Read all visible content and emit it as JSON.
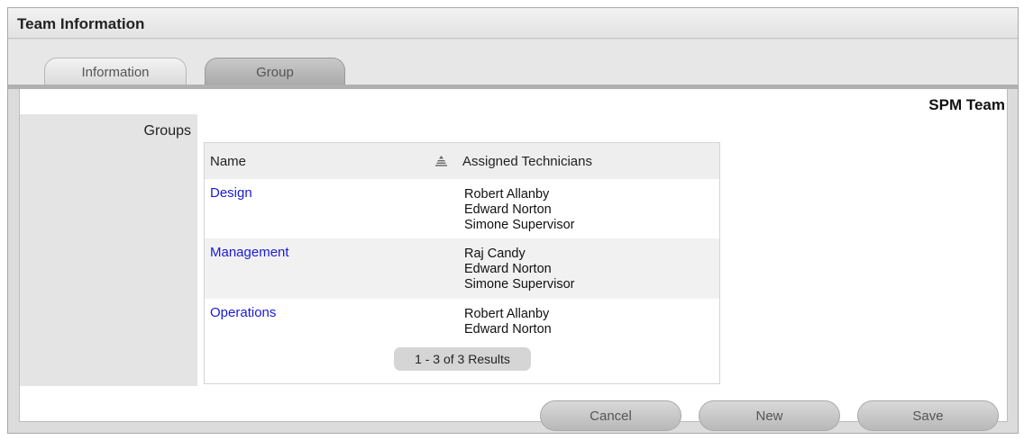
{
  "panel": {
    "title": "Team Information"
  },
  "tabs": [
    {
      "label": "Information"
    },
    {
      "label": "Group"
    }
  ],
  "team": {
    "name": "SPM Team"
  },
  "groups_label": "Groups",
  "table": {
    "columns": [
      "Name",
      "Assigned Technicians"
    ],
    "rows": [
      {
        "name": "Design",
        "technicians": [
          "Robert Allanby",
          "Edward Norton",
          "Simone Supervisor"
        ]
      },
      {
        "name": "Management",
        "technicians": [
          "Raj Candy",
          "Edward Norton",
          "Simone Supervisor"
        ]
      },
      {
        "name": "Operations",
        "technicians": [
          "Robert Allanby",
          "Edward Norton"
        ]
      }
    ],
    "pager": "1 - 3 of 3 Results",
    "sort_icon": "sort-ascending-icon"
  },
  "buttons": {
    "cancel": "Cancel",
    "new": "New",
    "save": "Save"
  }
}
